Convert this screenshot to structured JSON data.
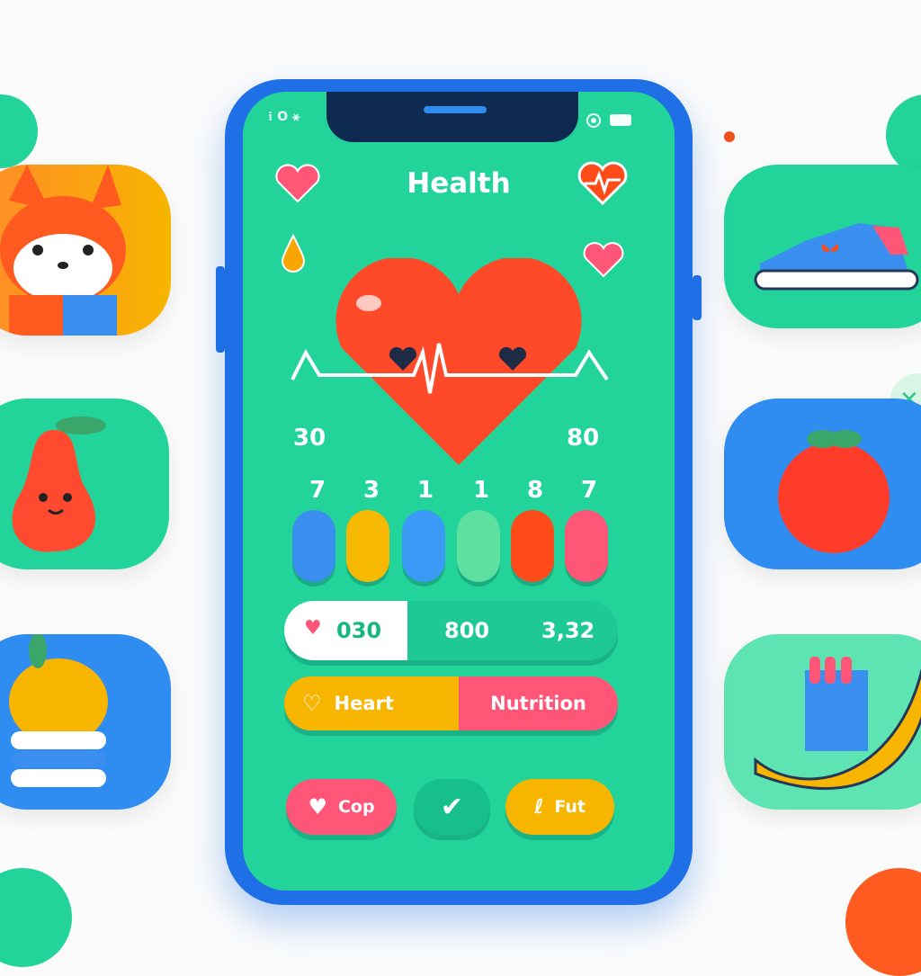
{
  "app": {
    "title": "Health"
  },
  "status_bar": {
    "left_icons": [
      "dot-icon",
      "circle-icon",
      "signal-icon"
    ],
    "right_icons": [
      "eye-icon",
      "battery-icon"
    ],
    "left_text": "⁞ O ⚹"
  },
  "header": {
    "left_icon": "heart-icon",
    "right_icon": "heart-pulse-icon"
  },
  "hero": {
    "left_value": "30",
    "right_value": "80",
    "icons": [
      "drop-icon",
      "small-heart-icon",
      "heart-ecg-icon"
    ]
  },
  "digits": [
    {
      "label": "7",
      "color": "#3a8ef0"
    },
    {
      "label": "3",
      "color": "#f6b800"
    },
    {
      "label": "1",
      "color": "#3a9af5"
    },
    {
      "label": "1",
      "color": "#5ddf9f"
    },
    {
      "label": "8",
      "color": "#ff4a1a"
    },
    {
      "label": "7",
      "color": "#ff5577"
    }
  ],
  "stats": {
    "first": "030",
    "second": "800",
    "third": "3,32"
  },
  "segments": {
    "heart": "Heart",
    "nutrition": "Nutrition"
  },
  "actions": {
    "cop": "Cop",
    "fut": "Fut"
  },
  "side_tiles": {
    "left": [
      "fox-avatar",
      "pear",
      "burger"
    ],
    "right": [
      "sneaker",
      "tomato",
      "banana"
    ]
  },
  "colors": {
    "screen": "#22d49a",
    "frame": "#1f6fe6",
    "notch": "#0e2a50",
    "pink": "#ff5577",
    "yellow": "#f8b500"
  }
}
